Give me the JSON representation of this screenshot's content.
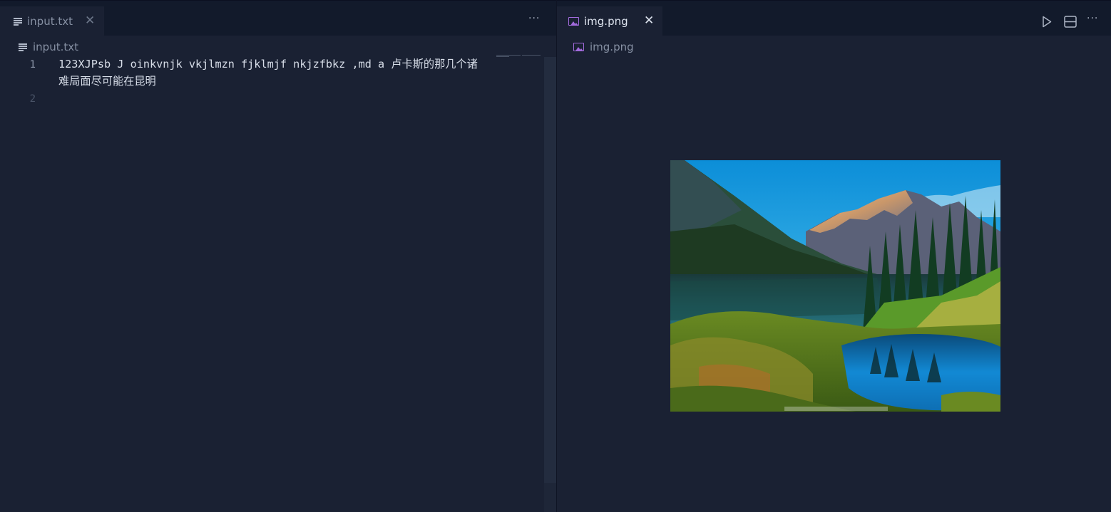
{
  "left_editor": {
    "tab": {
      "label": "input.txt",
      "close": "✕",
      "icon": "file-lines-icon"
    },
    "more_actions": "···",
    "breadcrumb": {
      "label": "input.txt",
      "icon": "file-lines-icon"
    },
    "lines": [
      {
        "number": "1",
        "text": "123XJPsb J oinkvnjk vkjlmzn fjklmjf nkjzfbkz ,md a 卢卡斯的那几个诸难局面尽可能在昆明"
      },
      {
        "number": "2",
        "text": ""
      }
    ]
  },
  "right_editor": {
    "tab": {
      "label": "img.png",
      "close": "✕",
      "icon": "image-file-icon"
    },
    "breadcrumb": {
      "label": "img.png",
      "icon": "image-file-icon"
    },
    "toolbar": {
      "run": "run-icon",
      "split": "split-editor-icon",
      "more": "···"
    },
    "image": {
      "subject": "mountain-lake-landscape",
      "watermark": "photophoto.cn"
    }
  },
  "colors": {
    "background": "#1a2133",
    "tabbar": "#121a2b",
    "active_text": "#dfe5f0",
    "inactive_text": "#8690a3",
    "line_number": "#6e788b",
    "image_icon": "#a36bdd"
  }
}
